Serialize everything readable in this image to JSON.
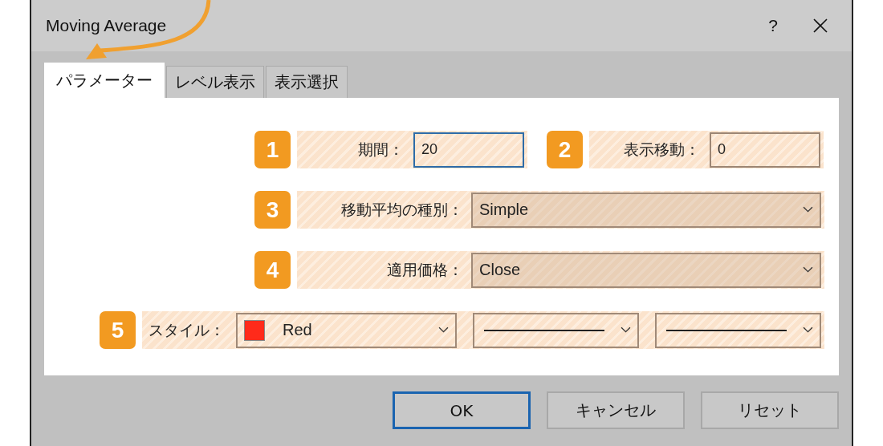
{
  "window": {
    "title": "Moving Average",
    "help": "?"
  },
  "tabs": [
    {
      "label": "パラメーター",
      "selected": true
    },
    {
      "label": "レベル表示",
      "selected": false
    },
    {
      "label": "表示選択",
      "selected": false
    }
  ],
  "rows": [
    {
      "kind": "params",
      "fields": [
        {
          "badge": "1",
          "label": "期間：",
          "kind": "input",
          "value": "20",
          "focused": true
        },
        {
          "badge": "2",
          "label": "表示移動：",
          "kind": "input",
          "value": "0",
          "focused": false
        }
      ]
    },
    {
      "kind": "params",
      "fields": [
        {
          "badge": "3",
          "label": "移動平均の種別：",
          "kind": "select",
          "value": "Simple"
        }
      ]
    },
    {
      "kind": "params",
      "fields": [
        {
          "badge": "4",
          "label": "適用価格：",
          "kind": "select",
          "value": "Close"
        }
      ]
    },
    {
      "kind": "style",
      "fields": [
        {
          "badge": "5",
          "label": "スタイル：",
          "kind": "style",
          "dropdowns": [
            {
              "kind": "color",
              "color": "#ff2a1a",
              "value": "Red"
            },
            {
              "kind": "line"
            },
            {
              "kind": "line"
            }
          ]
        }
      ]
    }
  ],
  "buttons": [
    {
      "label": "OK",
      "default": true
    },
    {
      "label": "キャンセル",
      "default": false
    },
    {
      "label": "リセット",
      "default": false
    }
  ]
}
